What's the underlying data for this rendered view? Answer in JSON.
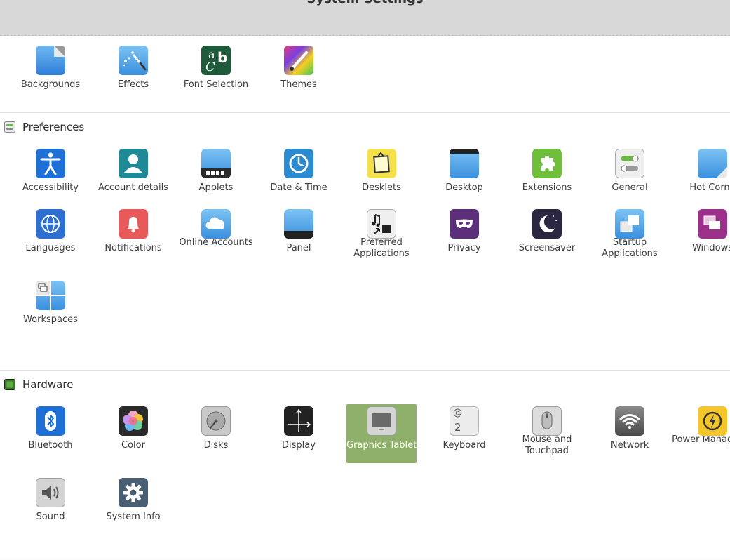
{
  "window": {
    "title": "System Settings"
  },
  "appearance": {
    "items": [
      {
        "label": "Backgrounds"
      },
      {
        "label": "Effects"
      },
      {
        "label": "Font Selection"
      },
      {
        "label": "Themes"
      }
    ]
  },
  "preferences": {
    "title": "Preferences",
    "items": [
      {
        "label": "Accessibility"
      },
      {
        "label": "Account details"
      },
      {
        "label": "Applets"
      },
      {
        "label": "Date & Time"
      },
      {
        "label": "Desklets"
      },
      {
        "label": "Desktop"
      },
      {
        "label": "Extensions"
      },
      {
        "label": "General"
      },
      {
        "label": "Hot Corne"
      },
      {
        "label": "Languages"
      },
      {
        "label": "Notifications"
      },
      {
        "label": "Online Accounts"
      },
      {
        "label": "Panel"
      },
      {
        "label": "Preferred Applications"
      },
      {
        "label": "Privacy"
      },
      {
        "label": "Screensaver"
      },
      {
        "label": "Startup Applications"
      },
      {
        "label": "Windows"
      },
      {
        "label": "Workspaces"
      }
    ]
  },
  "hardware": {
    "title": "Hardware",
    "items": [
      {
        "label": "Bluetooth"
      },
      {
        "label": "Color"
      },
      {
        "label": "Disks"
      },
      {
        "label": "Display"
      },
      {
        "label": "Graphics Tablet"
      },
      {
        "label": "Keyboard"
      },
      {
        "label": "Mouse and Touchpad"
      },
      {
        "label": "Network"
      },
      {
        "label": "Power Manageme"
      },
      {
        "label": "Sound"
      },
      {
        "label": "System Info"
      }
    ]
  },
  "icons": {
    "keyboard_glyph_top": "@",
    "keyboard_glyph_bottom": "2",
    "font_glyph_a": "a",
    "font_glyph_b": "b",
    "font_glyph_c": "C"
  },
  "colors": {
    "selection": "#8fb06a",
    "topbar": "#d8d8d8"
  }
}
